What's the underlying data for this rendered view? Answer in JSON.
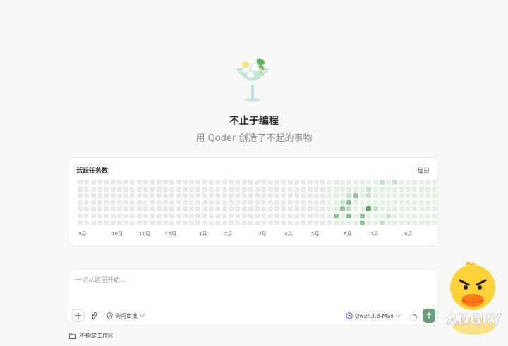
{
  "hero": {
    "icon": "cocktail-glass-icon",
    "title": "不止于编程",
    "subtitle": "用 Qoder 创造了不起的事物"
  },
  "activity": {
    "title": "活跃任务数",
    "period": "每日",
    "months": [
      "9月",
      "10月",
      "11月",
      "12月",
      "1月",
      "2月",
      "3月",
      "4月",
      "5月",
      "6月",
      "7月",
      "8月"
    ],
    "colors": {
      "empty": "#e9e9e9",
      "level1": "#e2f1e3",
      "level2": "#c6e3c9",
      "level3": "#8fc596",
      "level4": "#5c9e66"
    }
  },
  "composer": {
    "placeholder": "一切从这里开始...",
    "add_label": "+",
    "approval_label": "询问审批",
    "model_label": "Qwen3.8-Max"
  },
  "workspace": {
    "label": "不指定工作区"
  },
  "sticker": {
    "text": "ANGRY"
  },
  "accent": "#6d9d7d"
}
